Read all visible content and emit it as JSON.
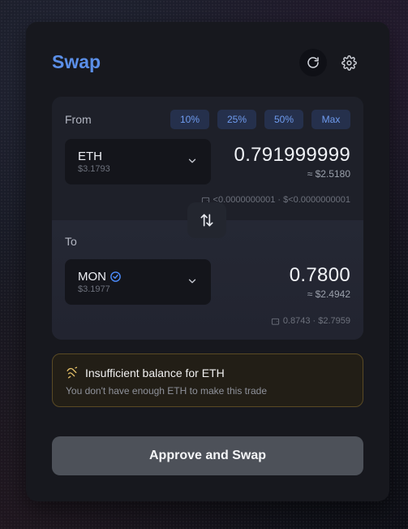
{
  "title": "Swap",
  "colors": {
    "accent": "#5b8fe8",
    "warning": "#e9c46a",
    "verified": "#4c8dff"
  },
  "from": {
    "label": "From",
    "percentages": [
      "10%",
      "25%",
      "50%",
      "Max"
    ],
    "token": {
      "symbol": "ETH",
      "price": "$3.1793"
    },
    "amount": "0.791999999",
    "fiat": "≈ $2.5180",
    "balance": "<0.0000000001 · $<0.0000000001"
  },
  "to": {
    "label": "To",
    "token": {
      "symbol": "MON",
      "price": "$3.1977",
      "verified": true
    },
    "amount": "0.7800",
    "fiat": "≈ $2.4942",
    "balance": "0.8743 · $2.7959"
  },
  "warning": {
    "title": "Insufficient balance for ETH",
    "text": "You don't have enough ETH to make this trade"
  },
  "action": {
    "label": "Approve and Swap"
  },
  "icons": {
    "refresh": "refresh-icon",
    "settings": "gear-icon",
    "chevron": "chevron-down-icon",
    "swap": "swap-arrows-icon",
    "wallet": "wallet-icon",
    "warning": "warning-icon",
    "verified": "verified-badge-icon"
  }
}
